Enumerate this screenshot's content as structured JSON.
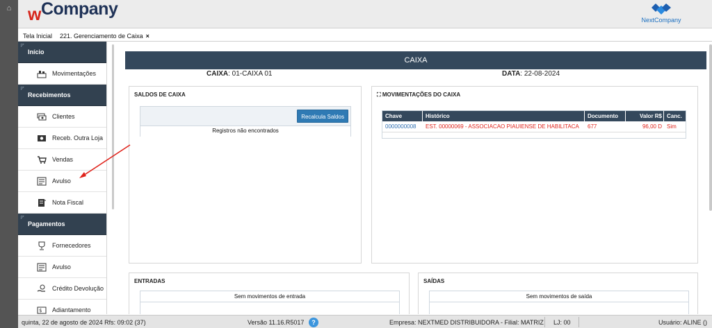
{
  "header": {
    "logo_w": "w",
    "logo_company": "Company",
    "partner_logo": "NextCompany"
  },
  "tabs": [
    {
      "label": "Tela Inicial"
    },
    {
      "label": "221. Gerenciamento de Caixa",
      "close": "×"
    }
  ],
  "sidebar": {
    "sections": [
      {
        "title": "Início",
        "items": [
          {
            "label": "Movimentações",
            "icon": "building-icon"
          }
        ]
      },
      {
        "title": "Recebimentos",
        "items": [
          {
            "label": "Clientes",
            "icon": "cash-icon"
          },
          {
            "label": "Receb. Outra Loja",
            "icon": "money-bill-icon"
          },
          {
            "label": "Vendas",
            "icon": "cart-icon"
          },
          {
            "label": "Avulso",
            "icon": "receipt-icon"
          },
          {
            "label": "Nota Fiscal",
            "icon": "document-icon"
          }
        ]
      },
      {
        "title": "Pagamentos",
        "items": [
          {
            "label": "Fornecedores",
            "icon": "trophy-icon"
          },
          {
            "label": "Avulso",
            "icon": "receipt-icon"
          },
          {
            "label": "Crédito Devolução",
            "icon": "coin-hand-icon"
          },
          {
            "label": "Adiantamento",
            "icon": "advance-icon"
          }
        ]
      }
    ]
  },
  "main": {
    "title": "CAIXA",
    "caixa_label": "CAIXA",
    "caixa_value": ": 01-CAIXA 01",
    "data_label": "DATA",
    "data_value": ": 22-08-2024",
    "saldos": {
      "title": "SALDOS DE CAIXA",
      "button": "Recalcula Saldos",
      "empty": "Registros não encontrados"
    },
    "movimentacoes": {
      "title": "MOVIMENTAÇÕES DO CAIXA",
      "expand_glyph": "⛶",
      "columns": [
        "Chave",
        "Histórico",
        "Documento",
        "Valor R$",
        "Canc."
      ],
      "rows": [
        {
          "chave": "0000000008",
          "historico": "EST. 00000069 - ASSOCIACAO PIAUIENSE DE HABILITACA",
          "documento": "677",
          "valor": "96,00 D",
          "canc": "Sim"
        }
      ]
    },
    "entradas": {
      "title": "ENTRADAS",
      "empty": "Sem movimentos de entrada"
    },
    "saidas": {
      "title": "SAÍDAS",
      "empty": "Sem movimentos de saída"
    }
  },
  "status": {
    "date": "quinta, 22 de agosto de 2024  Rfs: 09:02 (37)",
    "version": "Versão 11.16.R5017",
    "help": "?",
    "empresa": "Empresa: NEXTMED DISTRIBUIDORA - Filial: MATRIZ",
    "lj": "LJ: 00",
    "user": "Usuário: ALINE ()"
  },
  "colors": {
    "rail": "#545454",
    "nav_dark": "#324150",
    "table_header": "#34485c",
    "button_blue": "#2f7ab4",
    "link_blue": "#2f6fb2",
    "cancel_red": "#e0231b",
    "brand_red": "#d6261c",
    "brand_navy": "#1f3257"
  }
}
